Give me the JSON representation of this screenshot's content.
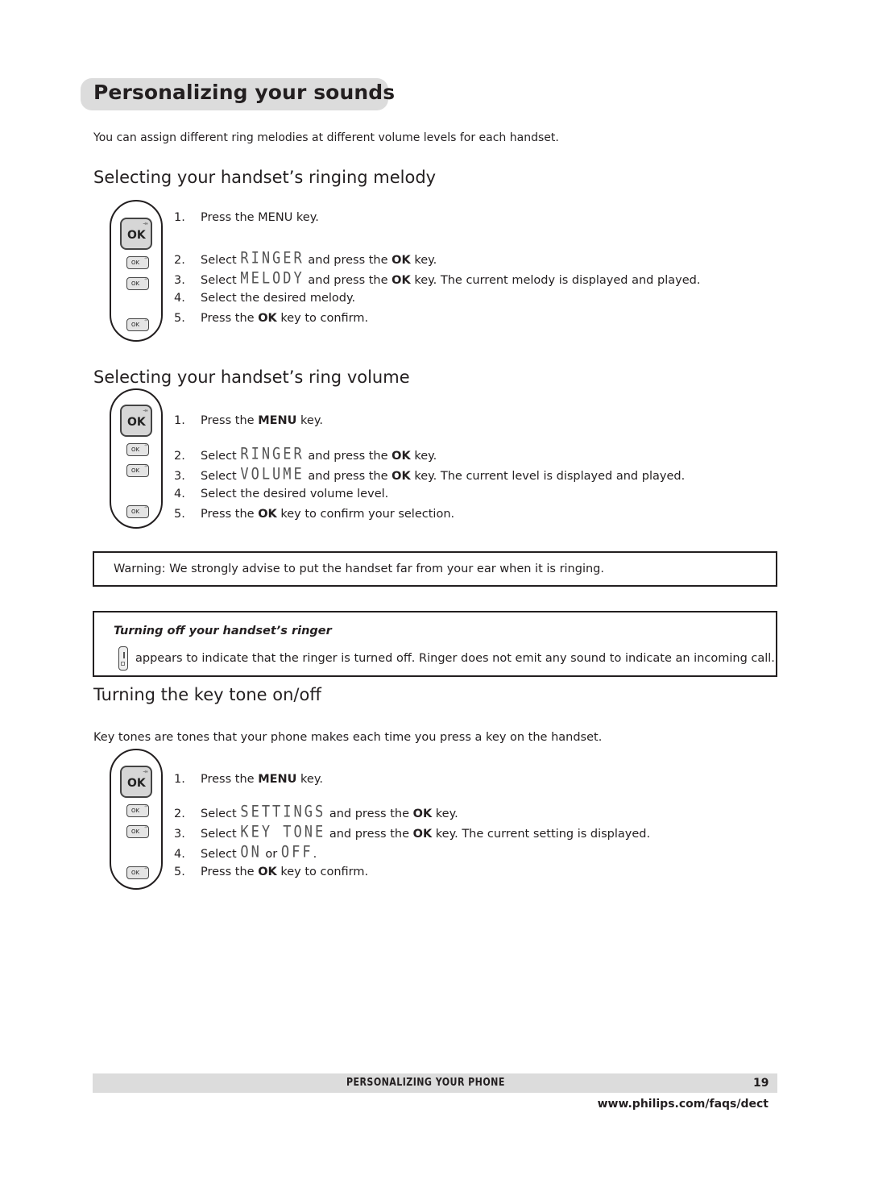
{
  "page": {
    "title": "Personalizing your sounds",
    "intro": "You can assign different ring melodies at different volume levels for each handset."
  },
  "sections": [
    {
      "heading": "Selecting your handset’s ringing melody",
      "steps": [
        {
          "num": "1.",
          "parts": [
            "Press the MENU key."
          ]
        },
        {
          "num": "2.",
          "pre": "Select ",
          "lcd": "RINGER",
          "mid": " and press the ",
          "bold": "OK",
          "post": " key."
        },
        {
          "num": "3.",
          "pre": "Select ",
          "lcd": "MELODY",
          "mid": " and press the ",
          "bold": "OK",
          "post": " key. The current melody is displayed and played."
        },
        {
          "num": "4.",
          "text": "Select the desired melody."
        },
        {
          "num": "5.",
          "pre": "Press the ",
          "bold": "OK",
          "post": " key to confirm."
        }
      ]
    },
    {
      "heading": "Selecting your handset’s ring volume",
      "steps": [
        {
          "num": "1.",
          "pre": "Press the ",
          "bold": "MENU",
          "post": " key."
        },
        {
          "num": "2.",
          "pre": "Select ",
          "lcd": "RINGER",
          "mid": " and press the ",
          "bold": "OK",
          "post": " key."
        },
        {
          "num": "3.",
          "pre": "Select ",
          "lcd": "VOLUME",
          "mid": " and press the ",
          "bold": "OK",
          "post": " key. The current level is displayed and played."
        },
        {
          "num": "4.",
          "text": "Select the desired volume level."
        },
        {
          "num": "5.",
          "pre": "Press the ",
          "bold": "OK",
          "post": " key to confirm your selection."
        }
      ]
    },
    {
      "heading": "Turning the key tone on/off",
      "intro": "Key tones are tones that your phone makes each time you press a key on the handset.",
      "steps": [
        {
          "num": "1.",
          "pre": "Press the ",
          "bold": "MENU",
          "post": " key."
        },
        {
          "num": "2.",
          "pre": "Select ",
          "lcd": "SETTINGS",
          "mid": " and press the ",
          "bold": "OK",
          "post": " key."
        },
        {
          "num": "3.",
          "pre": "Select ",
          "lcd": "KEY TONE",
          "mid": " and press the ",
          "bold": "OK",
          "post": " key. The current setting is displayed."
        },
        {
          "num": "4.",
          "pre": "Select ",
          "lcd": "ON",
          "mid": " or ",
          "lcd2": "OFF",
          "post": "."
        },
        {
          "num": "5.",
          "pre": "Press the ",
          "bold": "OK",
          "post": " key to confirm."
        }
      ]
    }
  ],
  "phone_icon": {
    "big_key": "OK",
    "small_key": "OK",
    "arrow": "↠"
  },
  "warning": "Warning:  We strongly advise to put the handset far from your ear when it is ringing.",
  "note": {
    "title": "Turning off your handset’s ringer",
    "text": "appears to indicate that the ringer is turned off.  Ringer does not emit any sound to indicate an incoming call."
  },
  "footer": {
    "section": "PERSONALIZING YOUR PHONE",
    "page_number": "19",
    "url": "www.philips.com/faqs/dect"
  }
}
